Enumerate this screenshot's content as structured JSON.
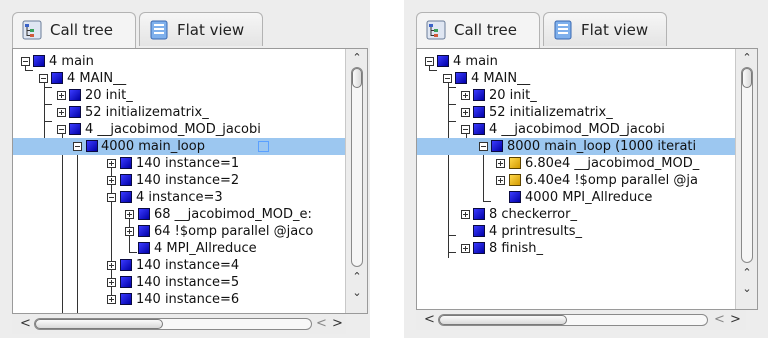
{
  "left": {
    "tabs": {
      "call_tree": "Call tree",
      "flat_view": "Flat view"
    },
    "rows": [
      {
        "text": "4 main"
      },
      {
        "text": "4 MAIN__"
      },
      {
        "text": "20 init_"
      },
      {
        "text": "52 initializematrix_"
      },
      {
        "text": "4 __jacobimod_MOD_jacobi"
      },
      {
        "text": "4000 main_loop"
      },
      {
        "text": "140 instance=1"
      },
      {
        "text": "140 instance=2"
      },
      {
        "text": "4 instance=3"
      },
      {
        "text": "68 __jacobimod_MOD_e:"
      },
      {
        "text": "64 !$omp parallel @jaco"
      },
      {
        "text": "4 MPI_Allreduce"
      },
      {
        "text": "140 instance=4"
      },
      {
        "text": "140 instance=5"
      },
      {
        "text": "140 instance=6"
      }
    ]
  },
  "right": {
    "tabs": {
      "call_tree": "Call tree",
      "flat_view": "Flat view"
    },
    "rows": [
      {
        "text": "4 main"
      },
      {
        "text": "4 MAIN__"
      },
      {
        "text": "20 init_"
      },
      {
        "text": "52 initializematrix_"
      },
      {
        "text": "4 __jacobimod_MOD_jacobi"
      },
      {
        "text": "8000 main_loop (1000 iterati"
      },
      {
        "text": "6.80e4 __jacobimod_MOD_"
      },
      {
        "text": "6.40e4 !$omp parallel @ja"
      },
      {
        "text": "4000 MPI_Allreduce"
      },
      {
        "text": "8 checkerror_"
      },
      {
        "text": "4 printresults_"
      },
      {
        "text": "8 finish_"
      }
    ]
  },
  "colors": {
    "selection": "#9cc7f0",
    "node_blue": "#0000c8",
    "node_gold": "#f0c020"
  },
  "icons": {
    "call_tree_tab": "call-tree-icon",
    "flat_view_tab": "flat-view-icon"
  }
}
